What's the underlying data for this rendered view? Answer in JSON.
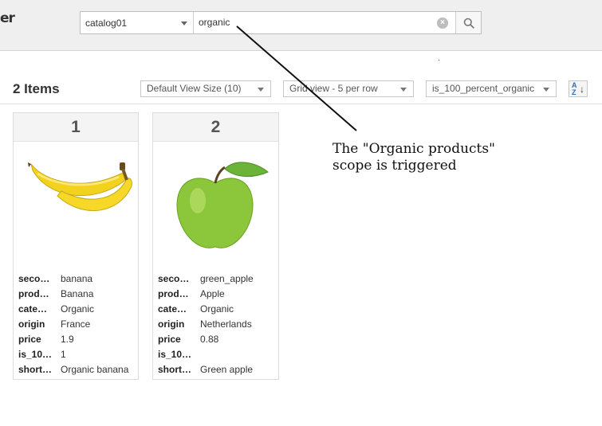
{
  "header": {
    "logo_text": "er",
    "catalog": "catalog01",
    "query": "organic"
  },
  "results": {
    "count_label": "2 Items",
    "view_size": "Default View Size (10)",
    "grid_view": "Grid view - 5 per row",
    "sort_field": "is_100_percent_organic"
  },
  "products": [
    {
      "rank": "1",
      "image": "banana",
      "fields": [
        {
          "key": "seco…",
          "value": "banana"
        },
        {
          "key": "prod…",
          "value": "Banana"
        },
        {
          "key": "cate…",
          "value": "Organic"
        },
        {
          "key": "origin",
          "value": "France"
        },
        {
          "key": "price",
          "value": "1.9"
        },
        {
          "key": "is_10…",
          "value": "1"
        },
        {
          "key": "short…",
          "value": "Organic banana"
        }
      ]
    },
    {
      "rank": "2",
      "image": "green apple",
      "fields": [
        {
          "key": "seco…",
          "value": "green_apple"
        },
        {
          "key": "prod…",
          "value": "Apple"
        },
        {
          "key": "cate…",
          "value": "Organic"
        },
        {
          "key": "origin",
          "value": "Netherlands"
        },
        {
          "key": "price",
          "value": "0.88"
        },
        {
          "key": "is_10…",
          "value": ""
        },
        {
          "key": "short…",
          "value": "Green apple"
        }
      ]
    }
  ],
  "annotation": {
    "line1": "The \"Organic products\"",
    "line2": "scope is triggered"
  },
  "icons": {
    "search": "search-icon",
    "clear": "clear-icon",
    "sort": "sort-az-icon",
    "caret": "chevron-down-icon"
  }
}
